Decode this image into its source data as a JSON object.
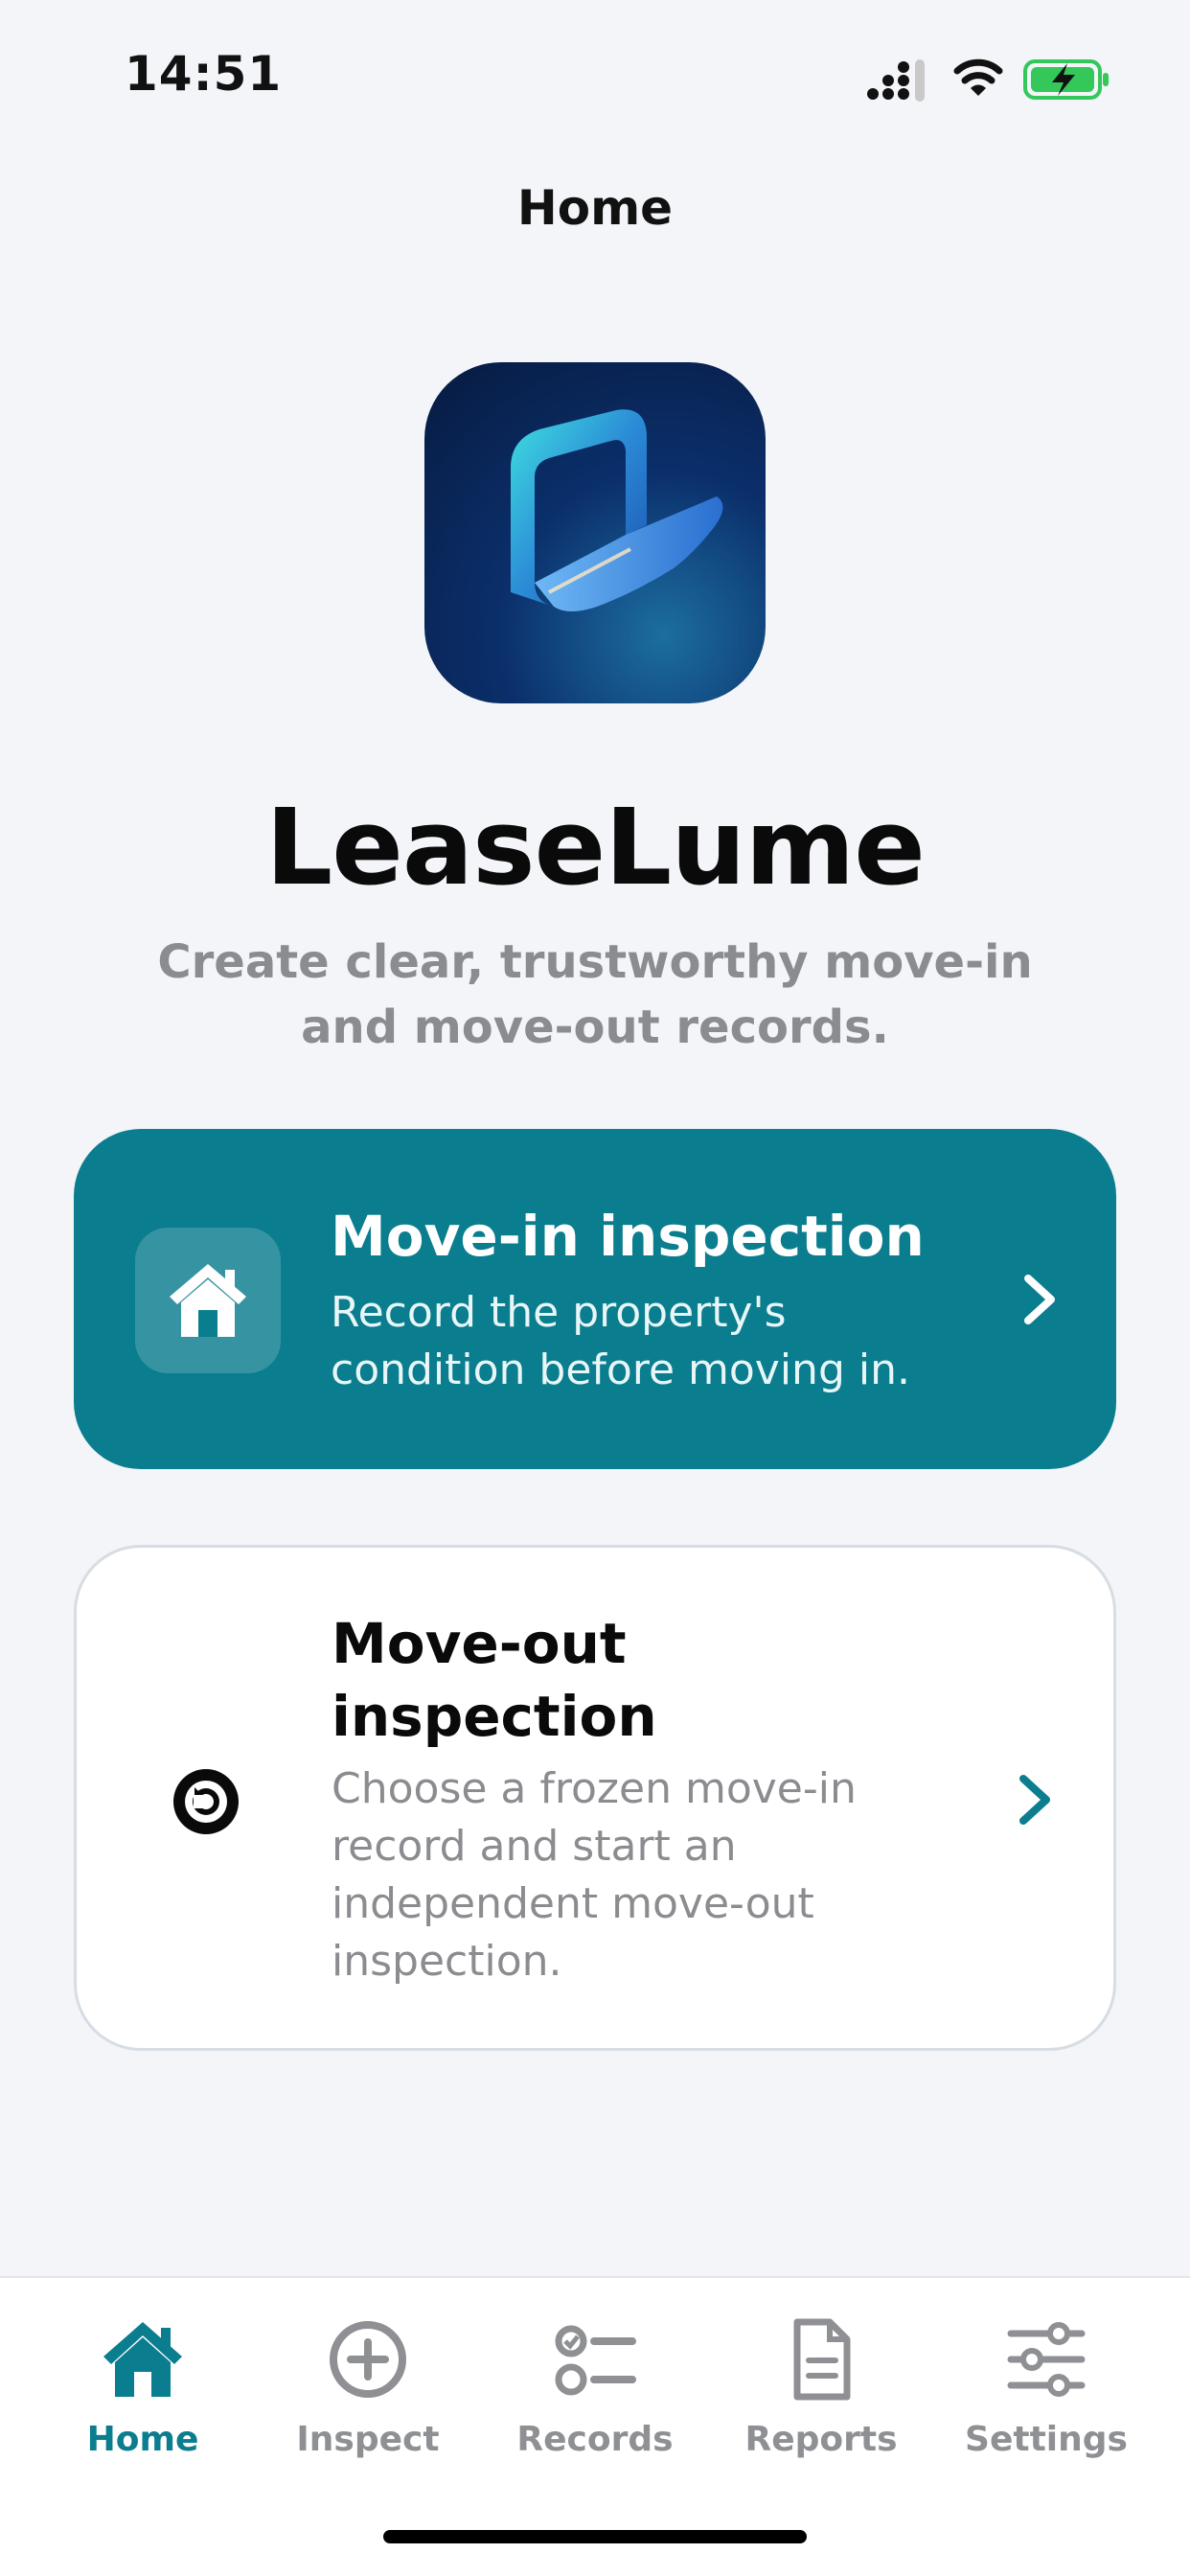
{
  "status_bar": {
    "time": "14:51",
    "signal_icon": "cellular-signal-icon",
    "wifi_icon": "wifi-icon",
    "battery_icon": "battery-charging-icon",
    "battery_color": "#34c759"
  },
  "header": {
    "title": "Home"
  },
  "app": {
    "icon": "leaselume-app-icon",
    "name": "LeaseLume",
    "tagline": "Create clear, trustworthy move-in and move-out records."
  },
  "actions": {
    "move_in": {
      "icon": "home-icon",
      "title": "Move-in inspection",
      "description": "Record the property's condition before moving in.",
      "background": "#0a7d8e"
    },
    "move_out": {
      "icon": "undo-circle-icon",
      "title": "Move-out inspection",
      "description": "Choose a frozen move-in record and start an independent move-out inspection."
    }
  },
  "tabbar": {
    "accent": "#0a7d8e",
    "tabs": [
      {
        "label": "Home",
        "icon": "home-icon",
        "active": true
      },
      {
        "label": "Inspect",
        "icon": "plus-circle-icon",
        "active": false
      },
      {
        "label": "Records",
        "icon": "checklist-icon",
        "active": false
      },
      {
        "label": "Reports",
        "icon": "document-icon",
        "active": false
      },
      {
        "label": "Settings",
        "icon": "sliders-icon",
        "active": false
      }
    ]
  }
}
